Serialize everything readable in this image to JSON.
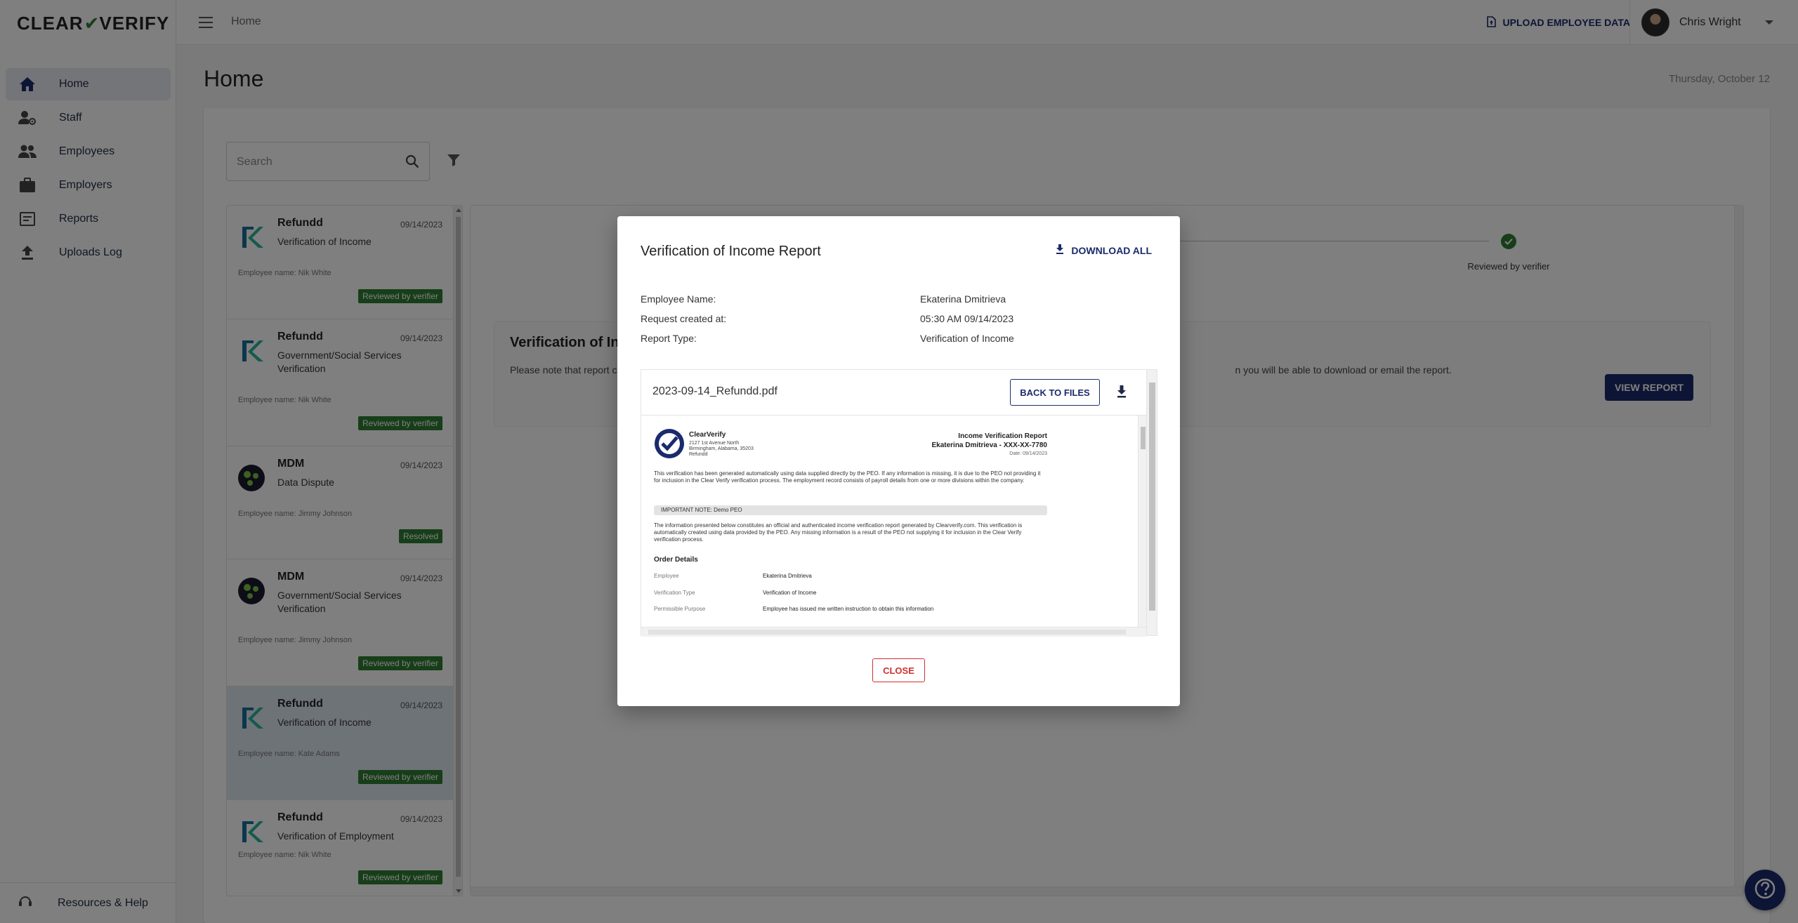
{
  "app": {
    "logo_left": "CLEAR",
    "logo_right": "VERIFY",
    "breadcrumb": "Home",
    "upload_label": "UPLOAD EMPLOYEE DATA",
    "user_name": "Chris Wright"
  },
  "sidebar": {
    "items": [
      {
        "label": "Home",
        "icon": "home-icon",
        "active": true
      },
      {
        "label": "Staff",
        "icon": "staff-icon"
      },
      {
        "label": "Employees",
        "icon": "employees-icon"
      },
      {
        "label": "Employers",
        "icon": "briefcase-icon"
      },
      {
        "label": "Reports",
        "icon": "reports-icon"
      },
      {
        "label": "Uploads Log",
        "icon": "upload-icon"
      }
    ],
    "resources_label": "Resources & Help"
  },
  "main": {
    "title": "Home",
    "date": "Thursday, October 12",
    "search_placeholder": "Search"
  },
  "requests": [
    {
      "company": "Refundd",
      "date": "09/14/2023",
      "type": "Verification of Income",
      "employee": "Employee name: Nik White",
      "status": "Reviewed by verifier",
      "logo": "refundd"
    },
    {
      "company": "Refundd",
      "date": "09/14/2023",
      "type": "Government/Social Services Verification",
      "employee": "Employee name: Nik White",
      "status": "Reviewed by verifier",
      "logo": "refundd"
    },
    {
      "company": "MDM",
      "date": "09/14/2023",
      "type": "Data Dispute",
      "employee": "Employee name: Jimmy Johnson",
      "status": "Resolved",
      "logo": "mdm"
    },
    {
      "company": "MDM",
      "date": "09/14/2023",
      "type": "Government/Social Services Verification",
      "employee": "Employee name: Jimmy Johnson",
      "status": "Reviewed by verifier",
      "logo": "mdm"
    },
    {
      "company": "Refundd",
      "date": "09/14/2023",
      "type": "Verification of Income",
      "employee": "Employee name: Kate Adams",
      "status": "Reviewed by verifier",
      "logo": "refundd",
      "selected": true
    },
    {
      "company": "Refundd",
      "date": "09/14/2023",
      "type": "Verification of Employment",
      "employee": "Employee name: Nik White",
      "status": "Reviewed by verifier",
      "logo": "refundd"
    }
  ],
  "detail": {
    "step_label": "Reviewed by verifier",
    "box_title": "Verification of Inc",
    "box_text_left": "Please note that report c",
    "box_text_right": "n you will be able to download or email the report.",
    "view_report": "VIEW REPORT"
  },
  "modal": {
    "title": "Verification of Income Report",
    "download_all": "DOWNLOAD ALL",
    "fields": [
      {
        "label": "Employee Name:",
        "value": "Ekaterina Dmitrieva"
      },
      {
        "label": "Request created at:",
        "value": "05:30 AM 09/14/2023"
      },
      {
        "label": "Report Type:",
        "value": "Verification of Income"
      }
    ],
    "file_name": "2023-09-14_Refundd.pdf",
    "back_to_files": "BACK TO FILES",
    "close": "CLOSE"
  },
  "pdf": {
    "brand": "ClearVerify",
    "address_1": "2127 1st Avenue North",
    "address_2": "Birmingham, Alabama, 35203",
    "address_3": "Refundd",
    "report_title": "Income Verification Report",
    "report_subject": "Ekaterina Dmitrieva - XXX-XX-7780",
    "report_date": "Date: 09/14/2023",
    "paragraph_1": "This verification has been generated automatically using data supplied directly by the PEO. If any information is missing, it is due to the PEO not providing it for inclusion in the Clear Verify verification process. The employment record consists of payroll details from one or more divisions within the company.",
    "important_note": "IMPORTANT NOTE: Demo PEO",
    "paragraph_2": "The information presented below constitutes an official and authenticated income verification report generated by Clearverify.com. This verification is automatically created using data provided by the PEO. Any missing information is a result of the PEO not supplying it for inclusion in the Clear Verify verification process.",
    "section": "Order Details",
    "rows": [
      {
        "label": "Employee",
        "value": "Ekaterina Dmitrieva"
      },
      {
        "label": "Verification Type",
        "value": "Verification of Income"
      },
      {
        "label": "Permissible Purpose",
        "value": "Employee has issued me written instruction to obtain this information"
      }
    ]
  },
  "colors": {
    "brand_navy": "#1a2b6d",
    "status_green": "#2e7d32",
    "close_red": "#d32f2f"
  }
}
